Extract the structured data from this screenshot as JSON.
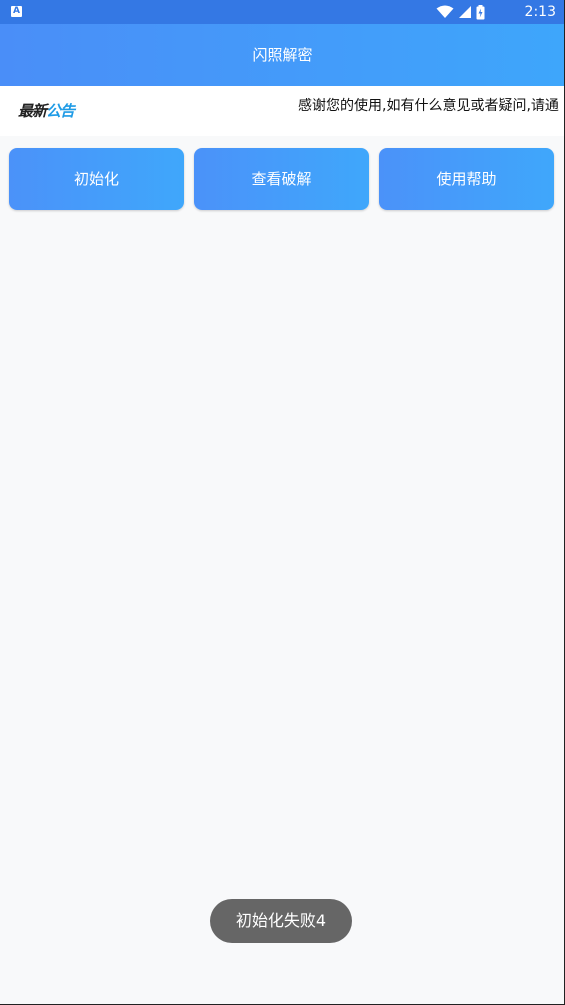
{
  "status_bar": {
    "app_badge": "A",
    "time": "2:13",
    "icons": [
      "wifi-icon",
      "signal-icon",
      "battery-charging-icon"
    ]
  },
  "app_bar": {
    "title": "闪照解密"
  },
  "notice": {
    "logo_part1": "最新",
    "logo_part2": "公告",
    "text": "感谢您的使用,如有什么意见或者疑问,请通"
  },
  "buttons": {
    "init": "初始化",
    "view_crack": "查看破解",
    "help": "使用帮助"
  },
  "toast": {
    "message": "初始化失败4"
  },
  "colors": {
    "status_bar": "#3478e4",
    "app_bar_start": "#4a8ef8",
    "app_bar_end": "#3ea6fb",
    "button_start": "#4b92f9",
    "button_end": "#3fa7fb",
    "background": "#f8f9fa",
    "notice_accent": "#1e9be6",
    "toast_bg": "#666666"
  }
}
